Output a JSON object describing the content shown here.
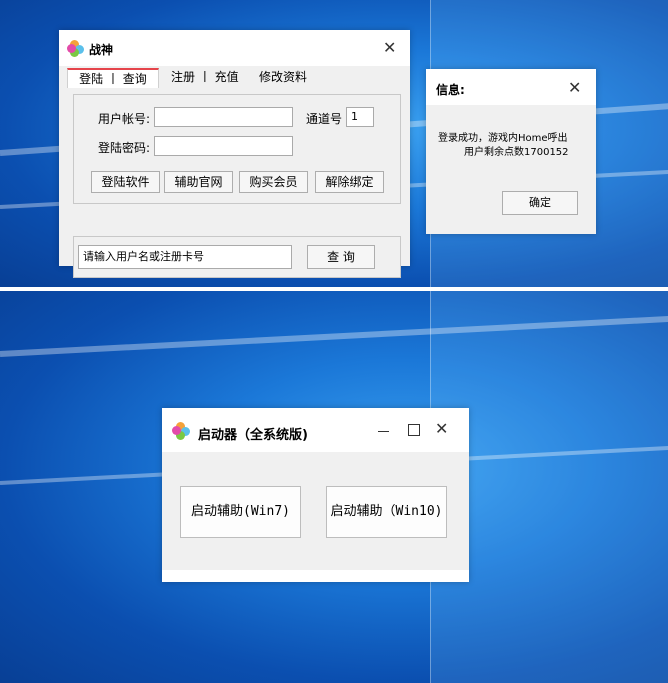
{
  "login_window": {
    "title": "战神",
    "tabs": [
      "登陆 丨 查询",
      "注册 丨 充值",
      "修改资料"
    ],
    "account_label": "用户帐号:",
    "account_value": "",
    "channel_label": "通道号",
    "channel_value": "1",
    "password_label": "登陆密码:",
    "password_value": "",
    "buttons": [
      "登陆软件",
      "辅助官网",
      "购买会员",
      "解除绑定"
    ],
    "query_input": "请输入用户名或注册卡号",
    "query_button": "查 询"
  },
  "info_dialog": {
    "title": "信息:",
    "message_line1": "登录成功，游戏内Home呼出",
    "message_line2": "用户剩余点数1700152",
    "ok_button": "确定"
  },
  "launcher_window": {
    "title": "启动器（全系统版)",
    "button_win7": "启动辅助(Win7)",
    "button_win10": "启动辅助（Win10)"
  },
  "colors": {
    "accent_tab": "#e5444b",
    "desktop_blue": "#1b78d8"
  },
  "icons": [
    "clover-app-icon",
    "close-icon",
    "minimize-icon",
    "maximize-icon"
  ]
}
